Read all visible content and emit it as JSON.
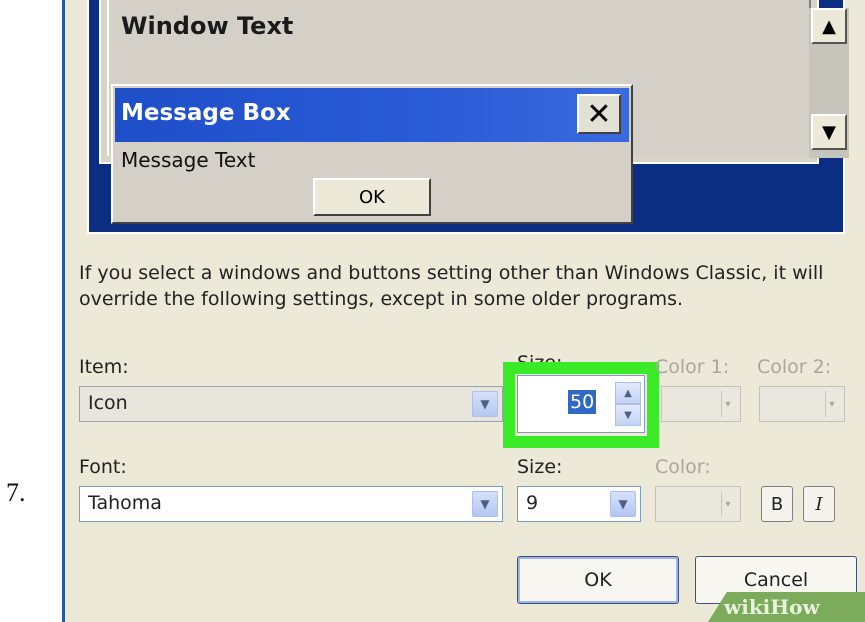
{
  "step_number": "7.",
  "preview": {
    "window_text": "Window Text",
    "message_box": {
      "title": "Message Box",
      "close_symbol": "✕",
      "text": "Message Text",
      "ok_label": "OK"
    },
    "scroll_up_symbol": "▲",
    "scroll_down_symbol": "▼"
  },
  "info_text": "If you select a windows and buttons setting other than Windows Classic, it will override the following settings, except in some older programs.",
  "item_row": {
    "item_label": "Item:",
    "item_value": "Icon",
    "size_label": "Size:",
    "size_value": "50",
    "color1_label": "Color 1:",
    "color2_label": "Color 2:"
  },
  "font_row": {
    "font_label": "Font:",
    "font_value": "Tahoma",
    "size_label": "Size:",
    "size_value": "9",
    "color_label": "Color:",
    "bold_label": "B",
    "italic_label": "I"
  },
  "buttons": {
    "ok": "OK",
    "cancel": "Cancel"
  },
  "watermark": "wikiHow",
  "colors": {
    "highlight": "#3bea27",
    "titlebar": "#2a5bd6",
    "desktop": "#0b2d82",
    "dialog_bg": "#ece9d8"
  },
  "icons": {
    "dropdown": "chevron-down-icon",
    "spin_up": "chevron-up-icon",
    "spin_down": "chevron-down-icon",
    "close": "close-icon"
  }
}
